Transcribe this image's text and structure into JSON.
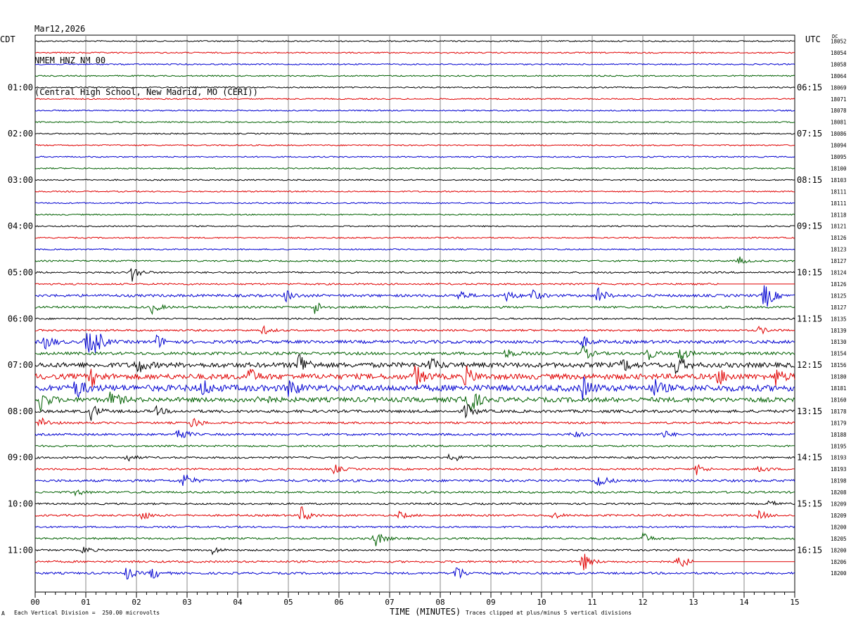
{
  "header": {
    "date": "Mar12,2026",
    "station": "NMEM HNZ NM 00",
    "location": "(Central High School, New Madrid, MO (CERI))"
  },
  "labels": {
    "left_tz": "CDT",
    "right_tz": "UTC",
    "dc_header": "DC"
  },
  "footer": {
    "corner_mark": "A",
    "scale_note": "Each Vertical Division =  250.00 microvolts",
    "xtitle": "TIME (MINUTES)",
    "clip_note": "Traces clipped at plus/minus 5 vertical divisions"
  },
  "chart_data": {
    "type": "line",
    "title": "",
    "xlabel": "TIME (MINUTES)",
    "xlim": [
      0,
      15
    ],
    "x_ticks": [
      "00",
      "01",
      "02",
      "03",
      "04",
      "05",
      "06",
      "07",
      "08",
      "09",
      "10",
      "11",
      "12",
      "13",
      "14",
      "15"
    ],
    "grid": true,
    "trace_colors": [
      "#000000",
      "#e00000",
      "#0000d0",
      "#006000"
    ],
    "left_hour_labels": [
      "01:00",
      "02:00",
      "03:00",
      "04:00",
      "05:00",
      "06:00",
      "07:00",
      "08:00",
      "09:00",
      "10:00",
      "11:00"
    ],
    "right_hour_labels": [
      "06:15",
      "07:15",
      "08:15",
      "09:15",
      "10:15",
      "11:15",
      "12:15",
      "13:15",
      "14:15",
      "15:15",
      "16:15"
    ],
    "dc_offsets": [
      "18052",
      "18054",
      "18058",
      "18064",
      "18069",
      "18071",
      "18078",
      "18081",
      "18086",
      "18094",
      "18095",
      "18100",
      "18103",
      "18111",
      "18111",
      "18118",
      "18121",
      "18126",
      "18123",
      "18127",
      "18124",
      "18126",
      "18125",
      "18127",
      "18135",
      "18139",
      "18130",
      "18154",
      "18156",
      "18180",
      "18181",
      "18160",
      "18178",
      "18179",
      "18188",
      "18195",
      "18193",
      "18193",
      "18198",
      "18208",
      "18209",
      "18209",
      "18200",
      "18205",
      "18200",
      "18206",
      "18200"
    ],
    "activity_levels": [
      1,
      1,
      1,
      1,
      1,
      1,
      1,
      1,
      1,
      1,
      1,
      1,
      1,
      1,
      1,
      1,
      1,
      1,
      1,
      1.2,
      1.3,
      1.3,
      2,
      1.6,
      1.3,
      1.5,
      2.4,
      2.2,
      3.8,
      4.2,
      4.8,
      3.6,
      2.2,
      1.6,
      1.7,
      1.4,
      1.4,
      1.4,
      1.8,
      1.5,
      1.4,
      1.5,
      1.3,
      1.5,
      1.3,
      1.5,
      1.6
    ],
    "events": [
      {
        "line": 19,
        "minute": 13.9,
        "amp": 6
      },
      {
        "line": 20,
        "minute": 1.9,
        "amp": 14
      },
      {
        "line": 22,
        "minute": 4.95,
        "amp": 9
      },
      {
        "line": 22,
        "minute": 8.35,
        "amp": 9
      },
      {
        "line": 22,
        "minute": 9.3,
        "amp": 8
      },
      {
        "line": 22,
        "minute": 9.8,
        "amp": 10
      },
      {
        "line": 22,
        "minute": 11.1,
        "amp": 14
      },
      {
        "line": 22,
        "minute": 14.4,
        "amp": 24
      },
      {
        "line": 23,
        "minute": 2.3,
        "amp": 9
      },
      {
        "line": 23,
        "minute": 5.5,
        "amp": 12
      },
      {
        "line": 25,
        "minute": 4.5,
        "amp": 6
      },
      {
        "line": 25,
        "minute": 14.3,
        "amp": 6
      },
      {
        "line": 26,
        "minute": 0.2,
        "amp": 12
      },
      {
        "line": 26,
        "minute": 1.0,
        "amp": 22
      },
      {
        "line": 26,
        "minute": 1.2,
        "amp": 16
      },
      {
        "line": 26,
        "minute": 2.4,
        "amp": 10
      },
      {
        "line": 26,
        "minute": 10.8,
        "amp": 9
      },
      {
        "line": 27,
        "minute": 9.3,
        "amp": 7
      },
      {
        "line": 27,
        "minute": 10.8,
        "amp": 12
      },
      {
        "line": 27,
        "minute": 12.05,
        "amp": 14
      },
      {
        "line": 27,
        "minute": 12.7,
        "amp": 14
      },
      {
        "line": 28,
        "minute": 2.0,
        "amp": 14
      },
      {
        "line": 28,
        "minute": 5.2,
        "amp": 22
      },
      {
        "line": 28,
        "minute": 7.8,
        "amp": 10
      },
      {
        "line": 28,
        "minute": 11.6,
        "amp": 10
      },
      {
        "line": 28,
        "minute": 12.65,
        "amp": 16
      },
      {
        "line": 29,
        "minute": 1.1,
        "amp": 14
      },
      {
        "line": 29,
        "minute": 4.2,
        "amp": 14
      },
      {
        "line": 29,
        "minute": 7.5,
        "amp": 18
      },
      {
        "line": 29,
        "minute": 8.5,
        "amp": 14
      },
      {
        "line": 29,
        "minute": 13.5,
        "amp": 12
      },
      {
        "line": 29,
        "minute": 14.6,
        "amp": 14
      },
      {
        "line": 30,
        "minute": 0.8,
        "amp": 16
      },
      {
        "line": 30,
        "minute": 3.3,
        "amp": 12
      },
      {
        "line": 30,
        "minute": 5.0,
        "amp": 16
      },
      {
        "line": 30,
        "minute": 10.8,
        "amp": 18
      },
      {
        "line": 30,
        "minute": 12.2,
        "amp": 14
      },
      {
        "line": 31,
        "minute": 0.1,
        "amp": 16
      },
      {
        "line": 31,
        "minute": 1.5,
        "amp": 14
      },
      {
        "line": 31,
        "minute": 4.4,
        "amp": 12
      },
      {
        "line": 31,
        "minute": 8.4,
        "amp": 18
      },
      {
        "line": 31,
        "minute": 8.6,
        "amp": 14
      },
      {
        "line": 32,
        "minute": 1.1,
        "amp": 12
      },
      {
        "line": 32,
        "minute": 8.5,
        "amp": 12
      },
      {
        "line": 32,
        "minute": 2.4,
        "amp": 6
      },
      {
        "line": 33,
        "minute": 0.1,
        "amp": 10
      },
      {
        "line": 33,
        "minute": 3.1,
        "amp": 9
      },
      {
        "line": 34,
        "minute": 2.8,
        "amp": 14
      },
      {
        "line": 34,
        "minute": 10.6,
        "amp": 6
      },
      {
        "line": 34,
        "minute": 12.4,
        "amp": 6
      },
      {
        "line": 36,
        "minute": 1.8,
        "amp": 6
      },
      {
        "line": 36,
        "minute": 8.2,
        "amp": 10
      },
      {
        "line": 37,
        "minute": 5.9,
        "amp": 7
      },
      {
        "line": 37,
        "minute": 13.05,
        "amp": 9
      },
      {
        "line": 37,
        "minute": 14.3,
        "amp": 6
      },
      {
        "line": 38,
        "minute": 2.9,
        "amp": 16
      },
      {
        "line": 38,
        "minute": 11.1,
        "amp": 14
      },
      {
        "line": 39,
        "minute": 0.8,
        "amp": 5
      },
      {
        "line": 40,
        "minute": 14.5,
        "amp": 5
      },
      {
        "line": 41,
        "minute": 2.1,
        "amp": 8
      },
      {
        "line": 41,
        "minute": 5.25,
        "amp": 14
      },
      {
        "line": 41,
        "minute": 7.2,
        "amp": 6
      },
      {
        "line": 41,
        "minute": 10.2,
        "amp": 6
      },
      {
        "line": 41,
        "minute": 14.3,
        "amp": 7
      },
      {
        "line": 43,
        "minute": 6.7,
        "amp": 14
      },
      {
        "line": 43,
        "minute": 12.0,
        "amp": 8
      },
      {
        "line": 44,
        "minute": 0.95,
        "amp": 6
      },
      {
        "line": 44,
        "minute": 3.5,
        "amp": 6
      },
      {
        "line": 45,
        "minute": 10.8,
        "amp": 16
      },
      {
        "line": 45,
        "minute": 12.7,
        "amp": 14
      },
      {
        "line": 46,
        "minute": 1.8,
        "amp": 10
      },
      {
        "line": 46,
        "minute": 2.3,
        "amp": 10
      },
      {
        "line": 46,
        "minute": 8.3,
        "amp": 14
      }
    ],
    "gaps": [
      {
        "line": 21,
        "from_minute": 13.5,
        "to_minute": 15
      },
      {
        "line": 45,
        "from_minute": 13.0,
        "to_minute": 15
      }
    ]
  }
}
